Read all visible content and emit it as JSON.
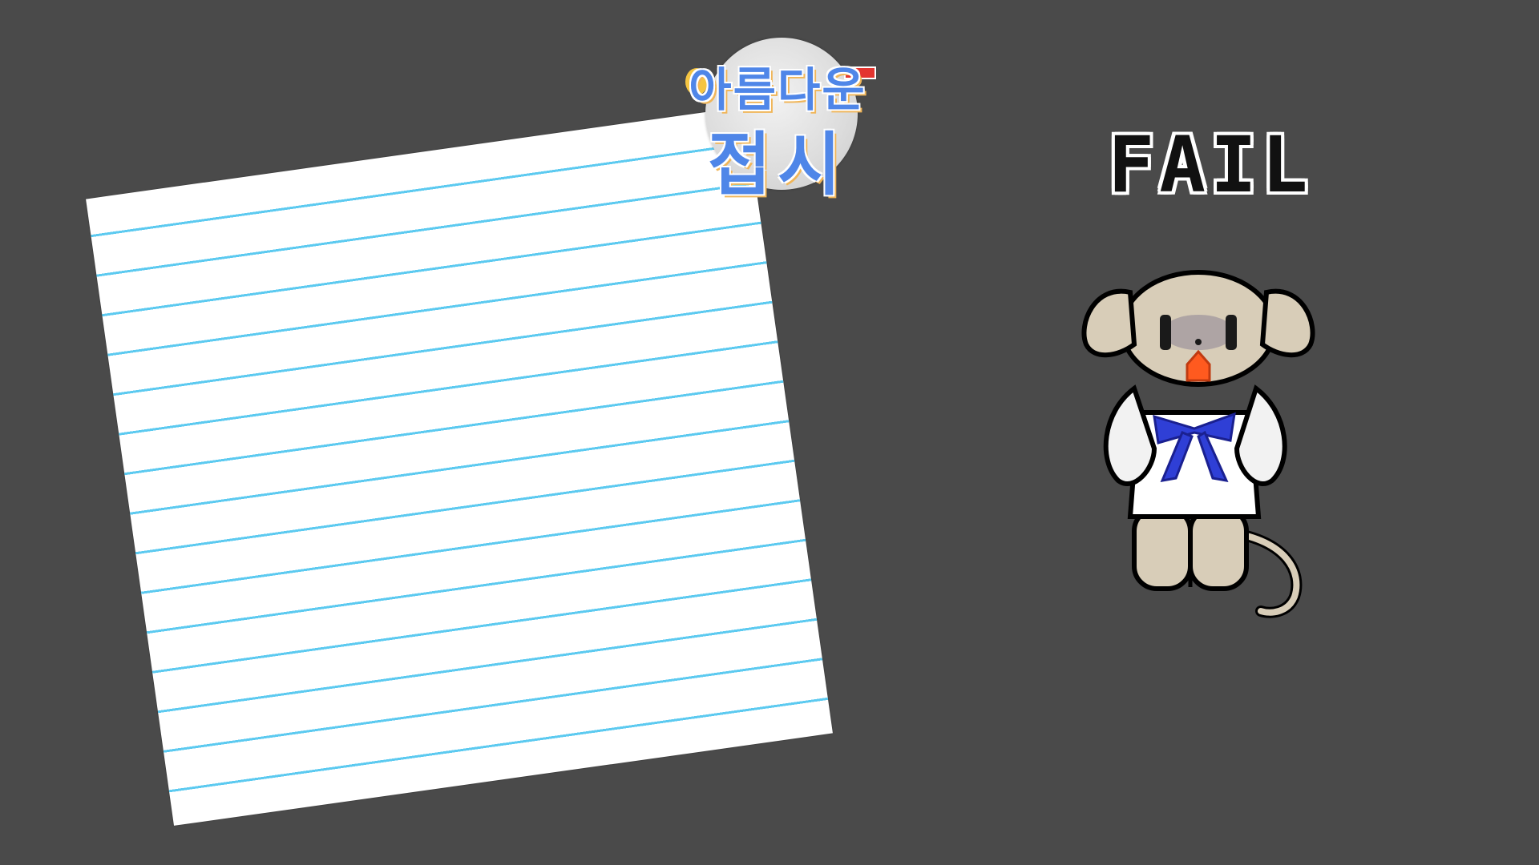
{
  "game": {
    "logo": {
      "line1": "아름다운",
      "line2": "접시"
    },
    "result": {
      "text": "FAIL"
    },
    "colors": {
      "background": "#4a4a4a",
      "paper": "#ffffff",
      "paper_lines": "#5ccaf0",
      "logo_text": "#4f86e8",
      "logo_shadow": "#f0b65a",
      "fail_text": "#111111",
      "character_fur": "#d8cdb8",
      "character_bow": "#2f3fd6",
      "character_mouth": "#ff5a1f"
    },
    "character": {
      "icon": "crying-dog-character"
    }
  }
}
